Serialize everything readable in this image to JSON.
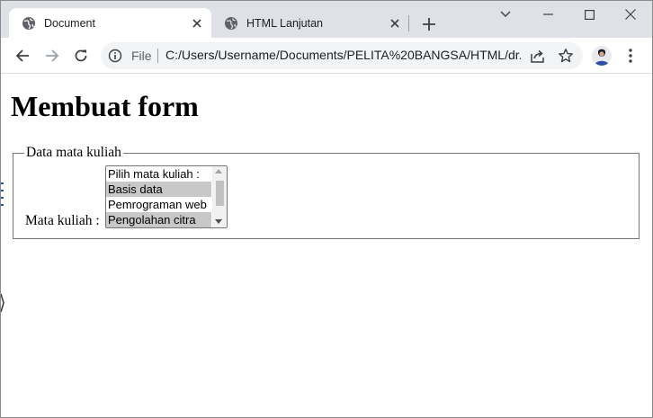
{
  "browser": {
    "tabs": [
      {
        "title": "Document",
        "active": true
      },
      {
        "title": "HTML Lanjutan",
        "active": false
      }
    ],
    "address": {
      "scheme": "File",
      "url": "C:/Users/Username/Documents/PELITA%20BANGSA/HTML/dr..."
    }
  },
  "page": {
    "heading": "Membuat form",
    "fieldset": {
      "legend": "Data mata kuliah",
      "label": "Mata kuliah :",
      "options": [
        {
          "text": "Pilih mata kuliah :",
          "selected": false
        },
        {
          "text": "Basis data",
          "selected": true
        },
        {
          "text": "Pemrograman web",
          "selected": false
        },
        {
          "text": "Pengolahan citra",
          "selected": true
        }
      ]
    }
  },
  "colors": {
    "tabstrip_bg": "#dee1e6",
    "omnibox_bg": "#f1f3f4",
    "selected_option_bg": "#c8c8c8"
  },
  "icons": [
    "globe-icon",
    "close-icon",
    "plus-icon",
    "chevron-down-icon",
    "minimize-icon",
    "maximize-icon",
    "window-close-icon",
    "back-arrow-icon",
    "forward-arrow-icon",
    "reload-icon",
    "info-icon",
    "share-icon",
    "star-icon",
    "avatar",
    "kebab-menu-icon"
  ]
}
